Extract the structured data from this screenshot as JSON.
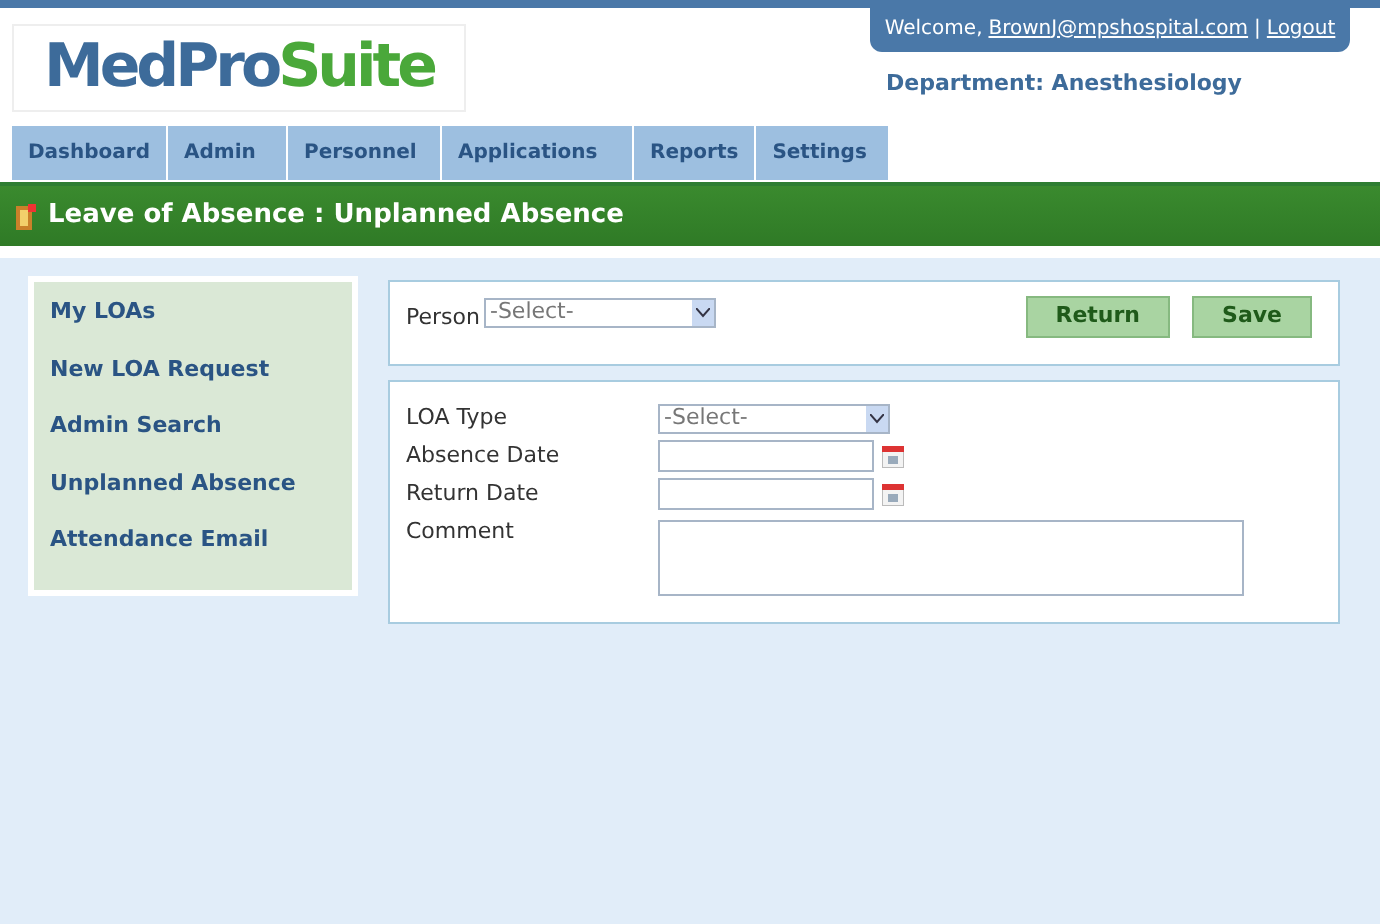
{
  "logo": {
    "first": "MedPro",
    "second": "Suite"
  },
  "user_bar": {
    "greeting": "Welcome,",
    "user": "BrownJ@mpshospital.com",
    "separator": "|",
    "logout": "Logout"
  },
  "department": "Department: Anesthesiology",
  "nav_tabs": [
    {
      "label": "Dashboard",
      "selected": false
    },
    {
      "label": "Admin",
      "selected": false
    },
    {
      "label": "Personnel",
      "selected": false
    },
    {
      "label": "Applications",
      "selected": false
    },
    {
      "label": "Reports",
      "selected": false
    },
    {
      "label": "Settings",
      "selected": false
    }
  ],
  "page_title": "Leave of Absence : Unplanned Absence",
  "sidebar": {
    "items": [
      {
        "label": "My LOAs"
      },
      {
        "label": "New LOA Request"
      },
      {
        "label": "Admin Search"
      },
      {
        "label": "Unplanned Absence"
      },
      {
        "label": "Attendance Email"
      }
    ]
  },
  "person": {
    "label": "Person",
    "value": "-Select-"
  },
  "buttons": [
    "Return",
    "Save"
  ],
  "form": [
    {
      "kind": "select",
      "label": "LOA Type",
      "value": "-Select-"
    },
    {
      "kind": "date",
      "label": "Absence Date"
    },
    {
      "kind": "date",
      "label": "Return Date"
    },
    {
      "kind": "textarea",
      "label": "Comment"
    }
  ]
}
